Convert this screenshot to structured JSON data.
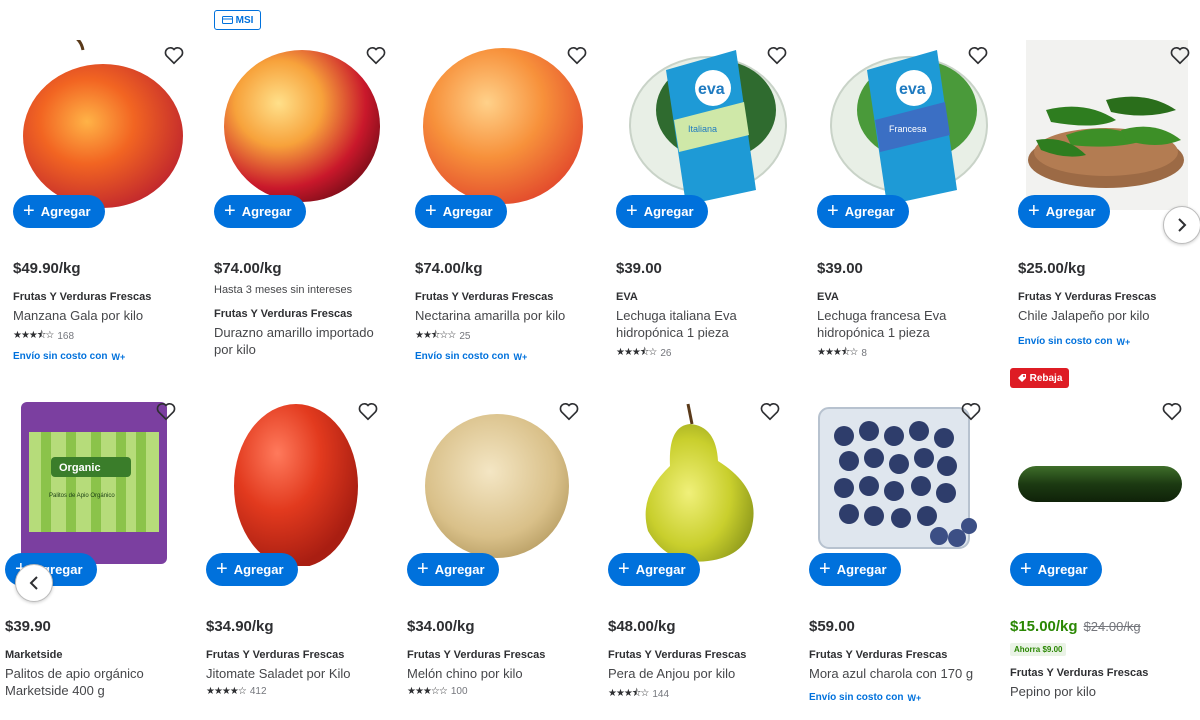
{
  "badges": {
    "msi": "MSI",
    "rebaja": "Rebaja"
  },
  "add_label": "Agregar",
  "shipping": {
    "text": "Envío sin costo con",
    "brand": "W+"
  },
  "products_row1": [
    {
      "price": "$49.90/kg",
      "brand": "Frutas Y Verduras Frescas",
      "name": "Manzana Gala por kilo",
      "rating": 3.5,
      "reviews": "168",
      "shipping": true
    },
    {
      "price": "$74.00/kg",
      "sub": "Hasta 3 meses sin intereses",
      "brand": "Frutas Y Verduras Frescas",
      "name": "Durazno amarillo importado por kilo"
    },
    {
      "price": "$74.00/kg",
      "brand": "Frutas Y Verduras Frescas",
      "name": "Nectarina amarilla por kilo",
      "rating": 2.5,
      "reviews": "25",
      "shipping": true
    },
    {
      "price": "$39.00",
      "brand": "EVA",
      "name": "Lechuga italiana Eva hidropónica 1 pieza",
      "rating": 3.5,
      "reviews": "26"
    },
    {
      "price": "$39.00",
      "brand": "EVA",
      "name": "Lechuga francesa Eva hidropónica 1 pieza",
      "rating": 3.5,
      "reviews": "8"
    },
    {
      "price": "$25.00/kg",
      "brand": "Frutas Y Verduras Frescas",
      "name": "Chile Jalapeño por kilo",
      "shipping": true
    }
  ],
  "products_row2": [
    {
      "price": "$39.90",
      "brand": "Marketside",
      "name": "Palitos de apio orgánico Marketside 400 g"
    },
    {
      "price": "$34.90/kg",
      "brand": "Frutas Y Verduras Frescas",
      "name": "Jitomate Saladet por Kilo",
      "rating": 4,
      "reviews": "412"
    },
    {
      "price": "$34.00/kg",
      "brand": "Frutas Y Verduras Frescas",
      "name": "Melón chino por kilo",
      "rating": 3,
      "reviews": "100"
    },
    {
      "price": "$48.00/kg",
      "brand": "Frutas Y Verduras Frescas",
      "name": "Pera de Anjou por kilo",
      "rating": 3.5,
      "reviews": "144"
    },
    {
      "price": "$59.00",
      "brand": "Frutas Y Verduras Frescas",
      "name": "Mora azul charola con 170 g",
      "shipping": true
    },
    {
      "price": "$15.00/kg",
      "was_price": "$24.00/kg",
      "savings": "Ahorra $9.00",
      "brand": "Frutas Y Verduras Frescas",
      "name": "Pepino por kilo"
    }
  ],
  "image_text": {
    "eva": "eva",
    "eva_italiana": "Italiana",
    "eva_francesa": "Francesa",
    "organic": "Organic",
    "apio": "Palitos de Apio Orgánico"
  },
  "colors": {
    "accent": "#0071dc",
    "sale": "#de1c24",
    "savings": "#2a8703"
  }
}
